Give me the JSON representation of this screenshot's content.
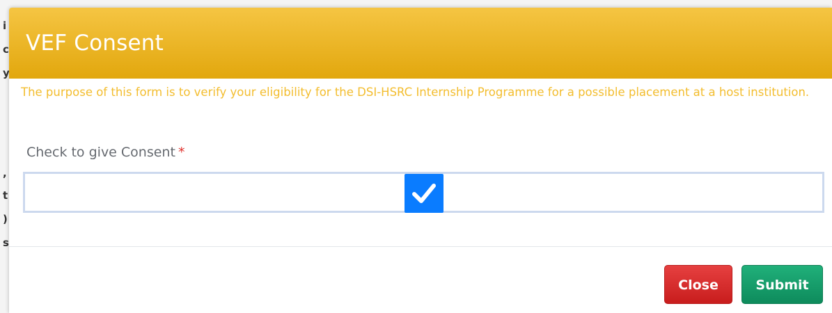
{
  "modal": {
    "title": "VEF Consent",
    "notice": "The purpose of this form is to verify your eligibility for the DSI-HSRC Internship Programme for a possible placement at a host institution.",
    "consent_label": "Check to give Consent",
    "required_marker": "*",
    "consent_checked": true
  },
  "footer": {
    "close_label": "Close",
    "submit_label": "Submit"
  },
  "colors": {
    "header": "#e8af1b",
    "notice_text": "#f3bd2e",
    "checkbox": "#0a7cff",
    "close_button": "#d42b2b",
    "submit_button": "#15996a",
    "required": "#e0332f"
  },
  "icons": {
    "checkbox": "checkmark-icon"
  }
}
